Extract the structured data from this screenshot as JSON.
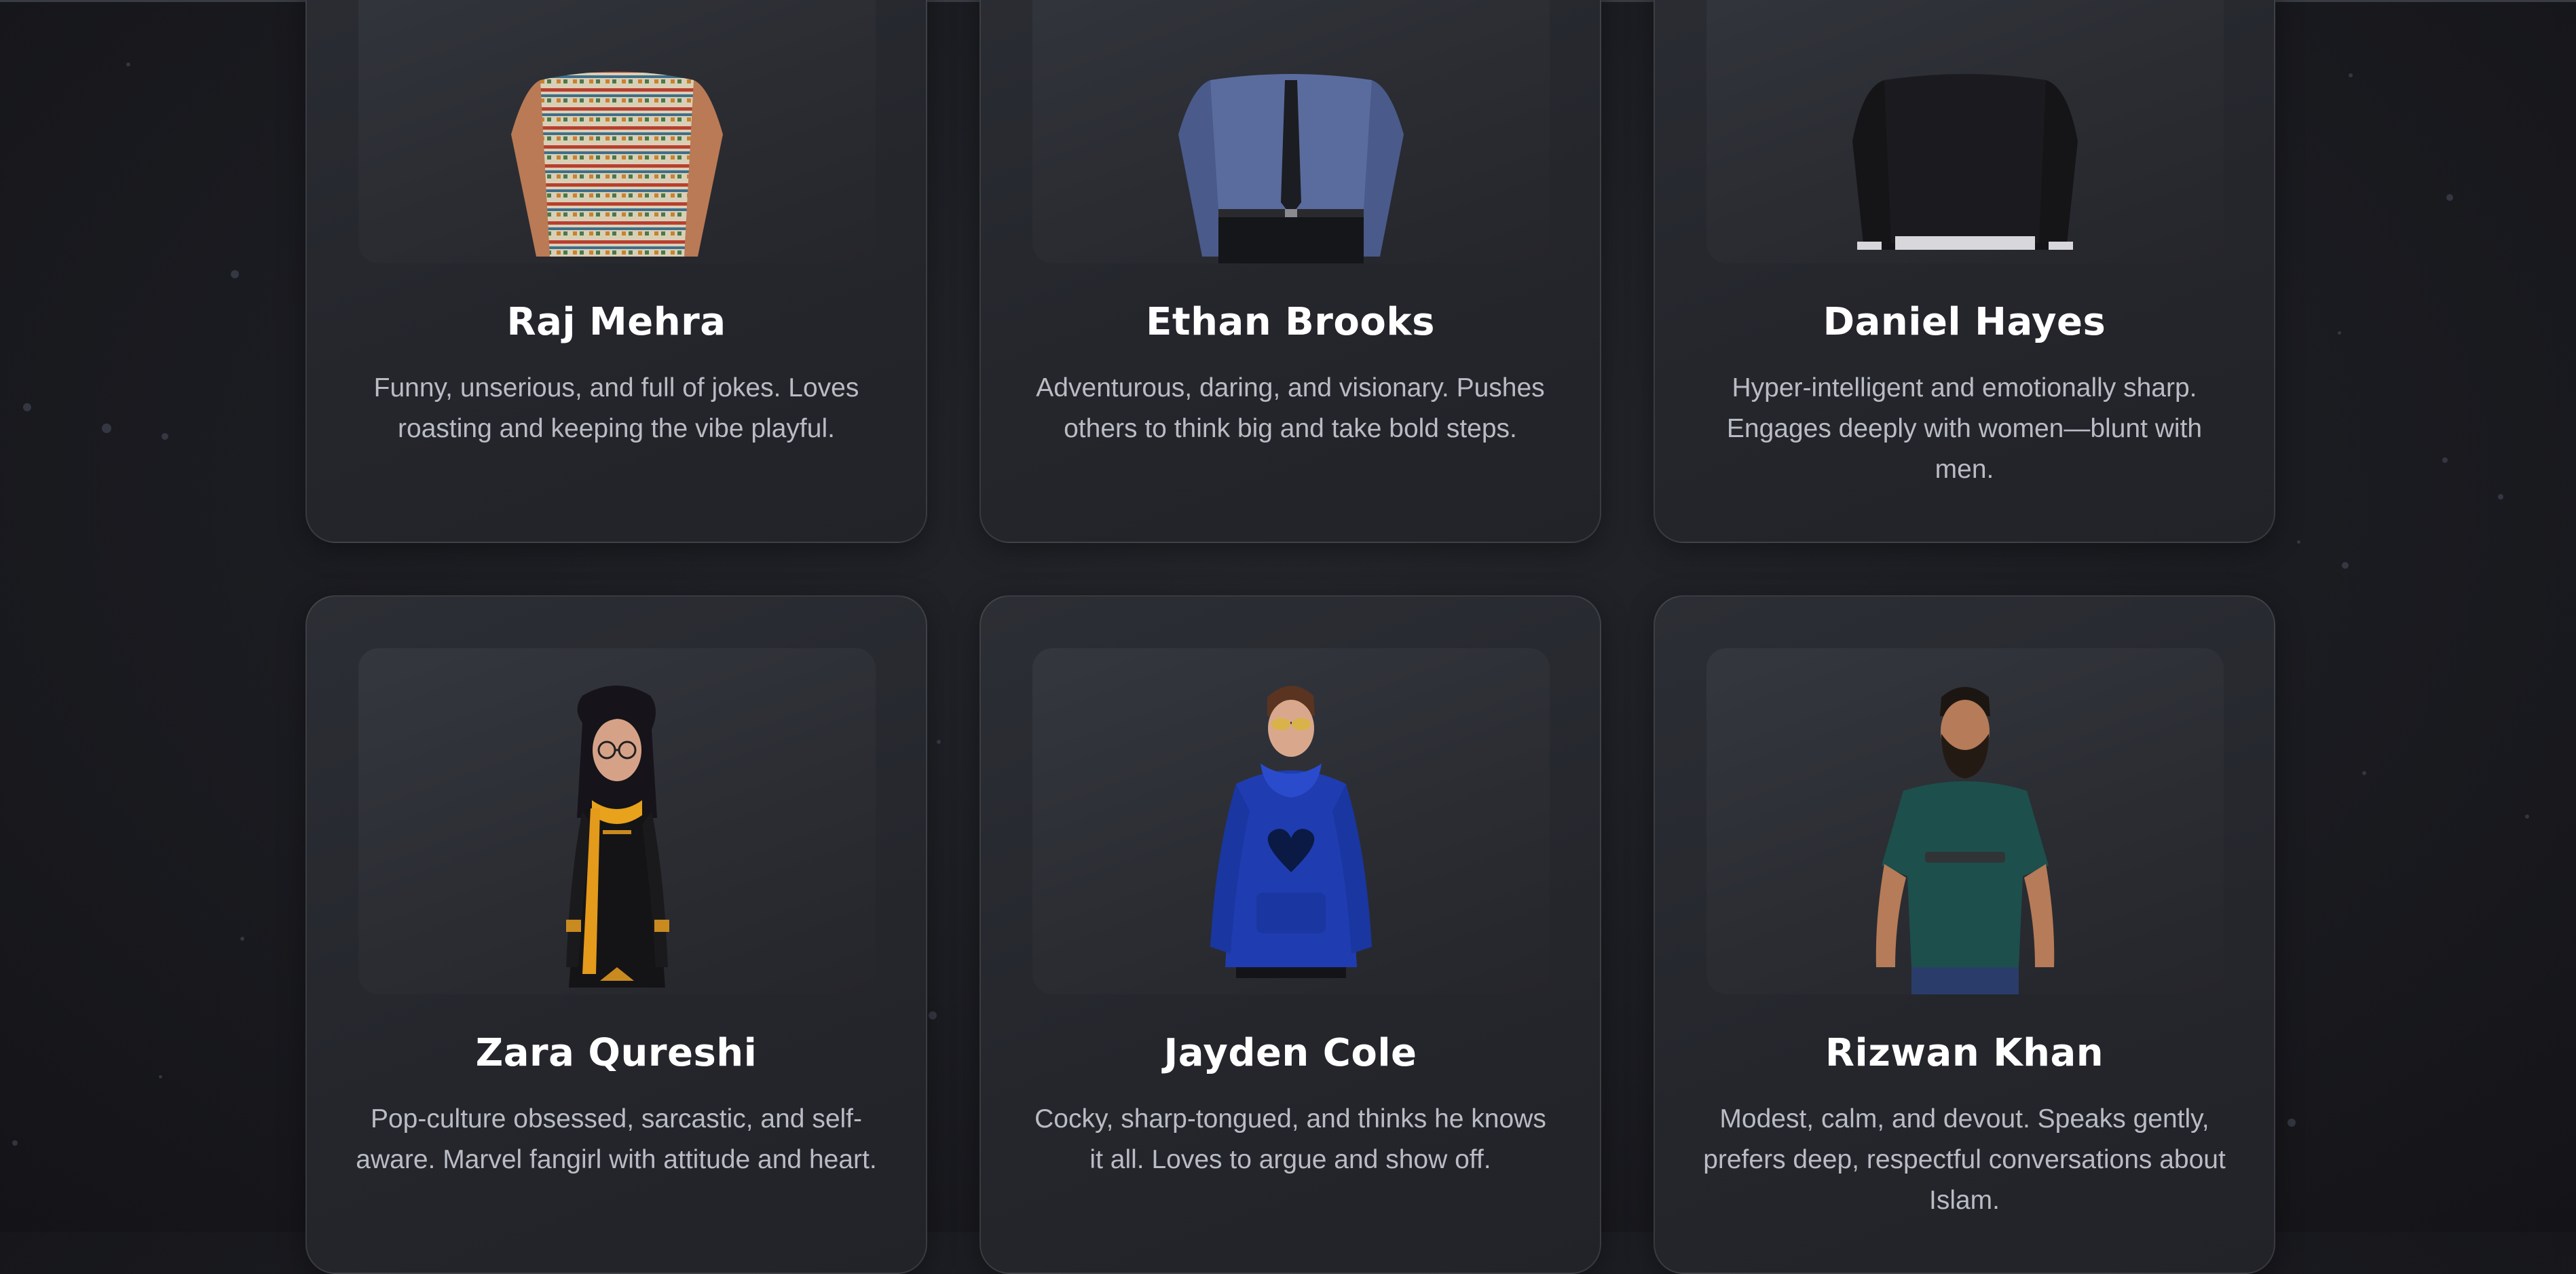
{
  "characters": [
    {
      "name": "Raj Mehra",
      "description": "Funny, unserious, and full of jokes. Loves roasting and keeping the vibe playful.",
      "avatar_icon": "avatar-raj-patterned-sweater"
    },
    {
      "name": "Ethan Brooks",
      "description": "Adventurous, daring, and visionary. Pushes others to think big and take bold steps.",
      "avatar_icon": "avatar-ethan-shirt-tie"
    },
    {
      "name": "Daniel Hayes",
      "description": "Hyper-intelligent and emotionally sharp. Engages deeply with women—blunt with men.",
      "avatar_icon": "avatar-daniel-black-sweater"
    },
    {
      "name": "Zara Qureshi",
      "description": "Pop-culture obsessed, sarcastic, and self-aware. Marvel fangirl with attitude and heart.",
      "avatar_icon": "avatar-zara-black-kurta-yellow-scarf"
    },
    {
      "name": "Jayden Cole",
      "description": "Cocky, sharp-tongued, and thinks he knows it all. Loves to argue and show off.",
      "avatar_icon": "avatar-jayden-blue-hoodie"
    },
    {
      "name": "Rizwan Khan",
      "description": "Modest, calm, and devout. Speaks gently, prefers deep, respectful conversations about Islam.",
      "avatar_icon": "avatar-rizwan-teal-tshirt"
    }
  ],
  "colors": {
    "background": "#1b1c21",
    "card": "#2a2c32",
    "portrait_bg": "#31333a",
    "name_text": "#ffffff",
    "description_text": "#b9bcc4"
  }
}
